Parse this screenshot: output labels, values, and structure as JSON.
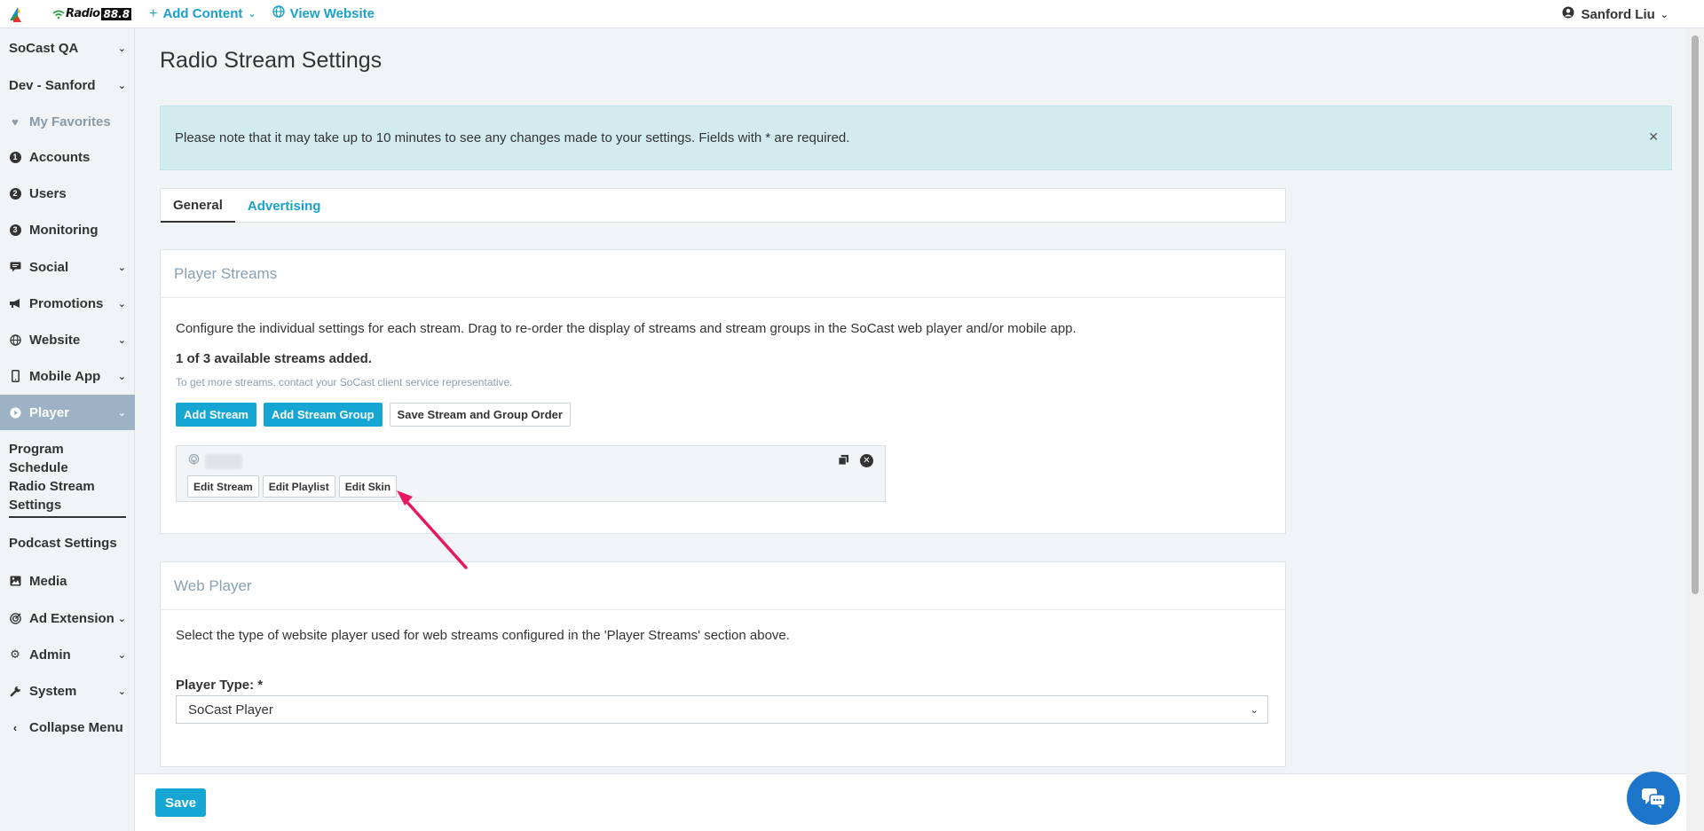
{
  "topbar": {
    "brand_text": "Radio",
    "brand_number": "88.8",
    "add_content": "Add Content",
    "view_website": "View Website",
    "user_name": "Sanford Liu"
  },
  "sidebar": {
    "org": "SoCast QA",
    "site": "Dev - Sanford",
    "favorites": "My Favorites",
    "accounts": "Accounts",
    "users": "Users",
    "monitoring": "Monitoring",
    "social": "Social",
    "promotions": "Promotions",
    "website": "Website",
    "mobile_app": "Mobile App",
    "player": "Player",
    "program_schedule": "Program Schedule",
    "radio_stream_settings": "Radio Stream Settings",
    "podcast_settings": "Podcast Settings",
    "media": "Media",
    "ad_extension": "Ad Extension",
    "admin": "Admin",
    "system": "System",
    "collapse": "Collapse Menu",
    "badges": {
      "accounts": "1",
      "users": "2",
      "monitoring": "3"
    }
  },
  "page": {
    "title": "Radio Stream Settings",
    "alert": "Please note that it may take up to 10 minutes to see any changes made to your settings. Fields with * are required.",
    "tabs": [
      "General",
      "Advertising"
    ]
  },
  "player_streams": {
    "heading": "Player Streams",
    "description": "Configure the individual settings for each stream. Drag to re-order the display of streams and stream groups in the SoCast web player and/or mobile app.",
    "count": "1 of 3 available streams added.",
    "hint": "To get more streams, contact your SoCast client service representative.",
    "add_stream": "Add Stream",
    "add_stream_group": "Add Stream Group",
    "save_order": "Save Stream and Group Order",
    "stream_buttons": {
      "edit_stream": "Edit Stream",
      "edit_playlist": "Edit Playlist",
      "edit_skin": "Edit Skin"
    }
  },
  "web_player": {
    "heading": "Web Player",
    "description": "Select the type of website player used for web streams configured in the 'Player Streams' section above.",
    "player_type_label": "Player Type: *",
    "player_type_value": "SoCast Player"
  },
  "footer": {
    "save": "Save"
  },
  "colors": {
    "accent": "#15a6d4",
    "link": "#1aa0c9",
    "active_nav": "#9db3c5",
    "alert_bg": "#d2ebef",
    "annotation": "#e8185f"
  }
}
